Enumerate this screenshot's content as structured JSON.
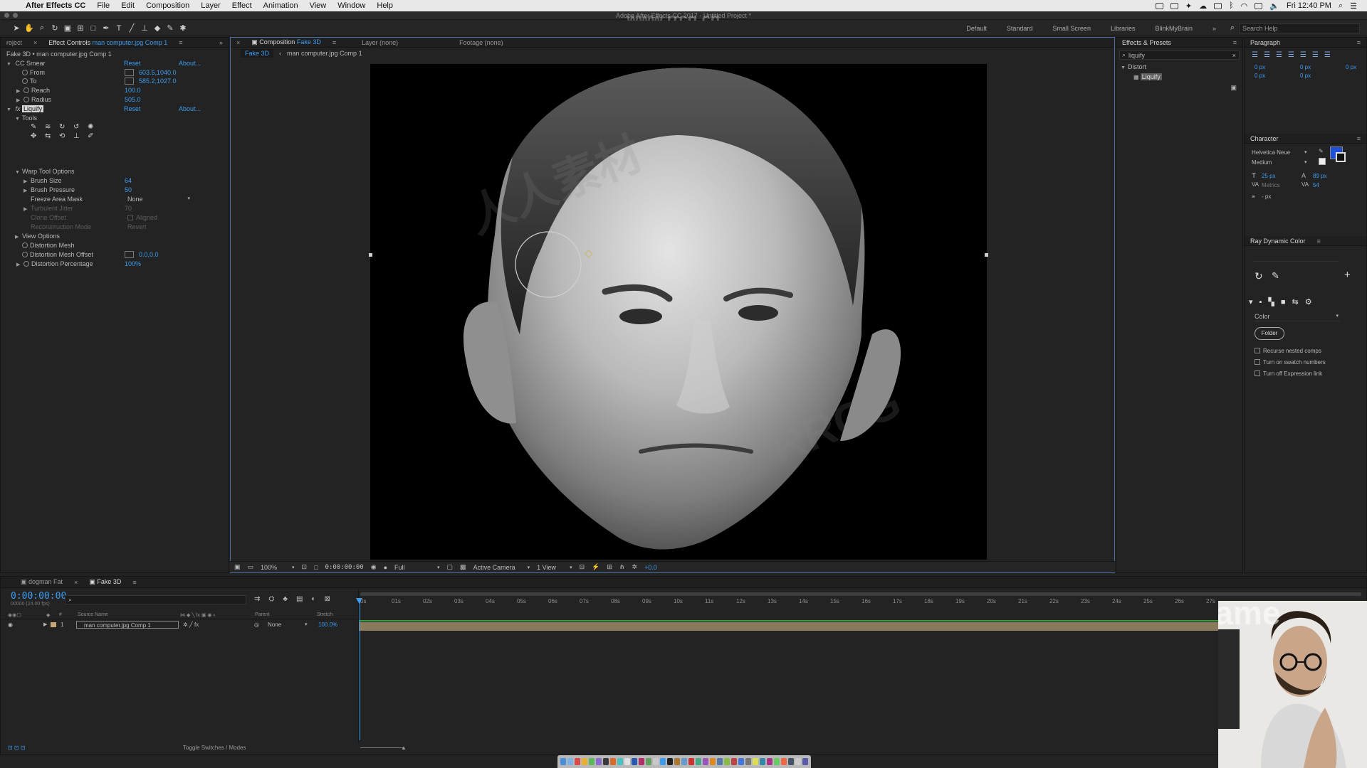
{
  "menubar": {
    "app": "After Effects CC",
    "items": [
      "File",
      "Edit",
      "Composition",
      "Layer",
      "Effect",
      "Animation",
      "View",
      "Window",
      "Help"
    ],
    "clock": "Fri 12:40 PM"
  },
  "titlebar": {
    "title": "Adobe After Effects CC 2017 - Untitled Project *",
    "watermark": "www.rrcg.cn"
  },
  "workspaces": [
    "Default",
    "Standard",
    "Small Screen",
    "Libraries",
    "BlinkMyBrain"
  ],
  "search_help": "Search Help",
  "left_panel": {
    "tab_project": "roject",
    "tab_effect_controls": "Effect Controls",
    "layer_name": "man computer.jpg Comp 1",
    "breadcrumb": "Fake 3D • man computer.jpg Comp 1",
    "cc_smear": {
      "name": "CC Smear",
      "reset": "Reset",
      "about": "About...",
      "from_label": "From",
      "from_value": "603.5,1040.0",
      "to_label": "To",
      "to_value": "585.2,1027.0",
      "reach_label": "Reach",
      "reach_value": "100.0",
      "radius_label": "Radius",
      "radius_value": "505.0"
    },
    "liquify": {
      "fx": "fx",
      "name": "Liquify",
      "reset": "Reset",
      "about": "About...",
      "tools_label": "Tools",
      "warp_options": "Warp Tool Options",
      "brush_size_label": "Brush Size",
      "brush_size": "64",
      "brush_pressure_label": "Brush Pressure",
      "brush_pressure": "50",
      "freeze_label": "Freeze Area Mask",
      "freeze_value": "None",
      "turbulent_label": "Turbulent Jitter",
      "turbulent_value": "70",
      "clone_label": "Clone Offset",
      "clone_value": "Aligned",
      "recon_label": "Reconstruction Mode",
      "recon_value": "Revert",
      "view_options": "View Options",
      "mesh_label": "Distortion Mesh",
      "mesh_offset_label": "Distortion Mesh Offset",
      "mesh_offset_value": "0.0,0.0",
      "pct_label": "Distortion Percentage",
      "pct_value": "100%"
    }
  },
  "viewer": {
    "tab_composition": "Composition",
    "comp_name": "Fake 3D",
    "tab_layer": "Layer (none)",
    "tab_footage": "Footage (none)",
    "crumb_1": "Fake 3D",
    "crumb_2": "man computer.jpg Comp 1",
    "watermark_cn": "人人素材",
    "watermark_en": "RRCG",
    "zoom": "100%",
    "timecode": "0:00:00:00",
    "resolution": "Full",
    "camera": "Active Camera",
    "views": "1 View",
    "exposure": "+0.0"
  },
  "effects_presets": {
    "title": "Effects & Presets",
    "search_value": "liquify",
    "category": "Distort",
    "result": "Liquify"
  },
  "paragraph": {
    "title": "Paragraph",
    "indent_left": "0 px",
    "indent_first": "0 px",
    "indent_right": "0 px",
    "space_before": "0 px",
    "space_after": "0 px"
  },
  "character": {
    "title": "Character",
    "font": "Helvetica Neue",
    "style": "Medium",
    "size": "25 px",
    "leading": "89 px",
    "kerning": "Metrics",
    "tracking": "54",
    "stroke": "- px",
    "fill_color": "#1f4fd8"
  },
  "ray_dynamic_color": {
    "title": "Ray Dynamic Color",
    "mode": "Color",
    "folder_button": "Folder",
    "opt1": "Recurse nested comps",
    "opt2": "Turn on swatch numbers",
    "opt3": "Turn off Expression link"
  },
  "timeline": {
    "tab_1": "dogman Fat",
    "tab_2": "Fake 3D",
    "timecode": "0:00:00:00",
    "fps_note": "00000 (24.00 fps)",
    "col_source": "Source Name",
    "col_parent": "Parent",
    "col_stretch": "Stretch",
    "layer_index": "1",
    "layer_name": "man computer.jpg Comp 1",
    "parent_value": "None",
    "stretch_value": "100.0%",
    "ticks": [
      "0s",
      "01s",
      "02s",
      "03s",
      "04s",
      "05s",
      "06s",
      "07s",
      "08s",
      "09s",
      "10s",
      "11s",
      "12s",
      "13s",
      "14s",
      "15s",
      "16s",
      "17s",
      "18s",
      "19s",
      "20s",
      "21s",
      "22s",
      "23s",
      "24s",
      "25s",
      "26s",
      "27s"
    ],
    "toggle_label": "Toggle Switches / Modes"
  },
  "webcam": {
    "brand": "Holdframe"
  },
  "colors": {
    "accent": "#3d9cf0",
    "panel": "#232323",
    "track": "#8a7a5c"
  }
}
